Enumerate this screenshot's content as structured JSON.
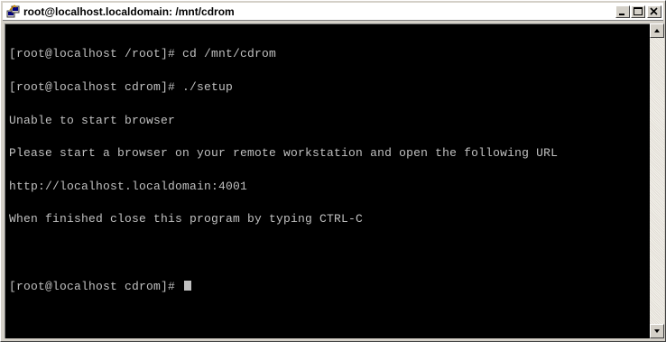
{
  "window": {
    "title": "root@localhost.localdomain: /mnt/cdrom",
    "icon": "putty-terminal-icon",
    "controls": [
      "minimize-icon",
      "maximize-icon",
      "close-icon"
    ]
  },
  "terminal": {
    "lines": [
      "[root@localhost /root]# cd /mnt/cdrom",
      "[root@localhost cdrom]# ./setup",
      "Unable to start browser",
      "Please start a browser on your remote workstation and open the following URL",
      "http://localhost.localdomain:4001",
      "When finished close this program by typing CTRL-C",
      "",
      "[root@localhost cdrom]# "
    ],
    "colors": {
      "background": "#000000",
      "foreground": "#c0c0c0"
    }
  },
  "scrollbar": {
    "up_icon": "arrow-up-icon",
    "down_icon": "arrow-down-icon"
  }
}
